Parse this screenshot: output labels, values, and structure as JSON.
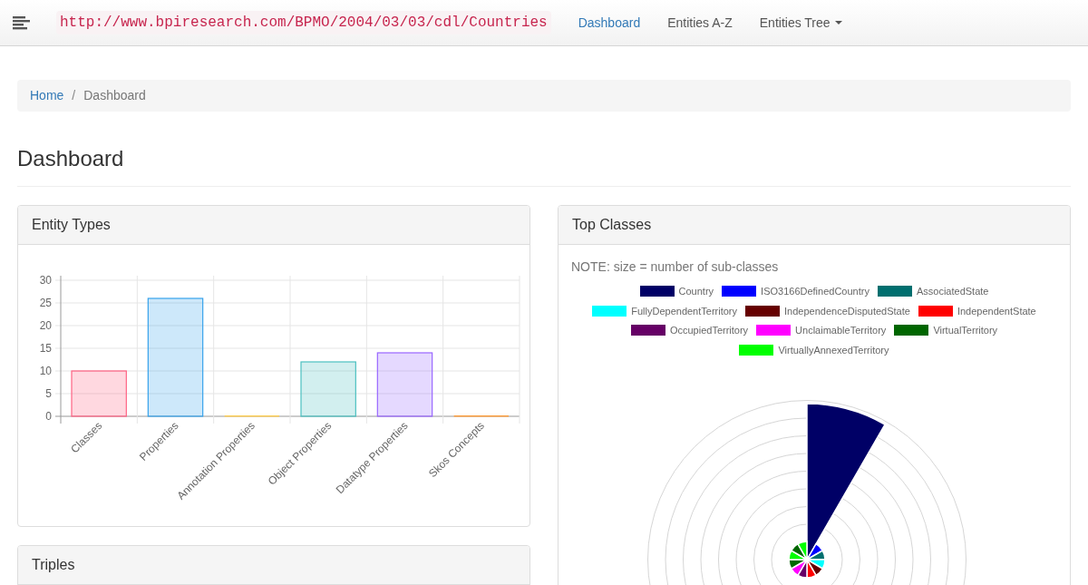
{
  "navbar": {
    "url": "http://www.bpiresearch.com/BPMO/2004/03/03/cdl/Countries",
    "links": [
      {
        "label": "Dashboard",
        "selected": true,
        "dropdown": false
      },
      {
        "label": "Entities A-Z",
        "selected": false,
        "dropdown": false
      },
      {
        "label": "Entities Tree",
        "selected": false,
        "dropdown": true
      }
    ]
  },
  "breadcrumb": {
    "separator": "/",
    "items": [
      {
        "label": "Home",
        "kind": "link"
      },
      {
        "label": "Dashboard",
        "kind": "current"
      }
    ]
  },
  "page_title": "Dashboard",
  "entity_types": {
    "title": "Entity Types",
    "chart_data": {
      "type": "bar",
      "categories": [
        "Classes",
        "Properties",
        "Annotation Properties",
        "Object Properties",
        "Datatype Properties",
        "Skos Concepts"
      ],
      "values": [
        10,
        26,
        0,
        12,
        14,
        0
      ],
      "colors": [
        "#ff6384",
        "#36a2eb",
        "#ffce56",
        "#4bc0c0",
        "#9966ff",
        "#ff9f40"
      ],
      "ylim": [
        0,
        30
      ],
      "yticks": [
        0,
        5,
        10,
        15,
        20,
        25,
        30
      ],
      "grid": true
    }
  },
  "top_classes": {
    "title": "Top Classes",
    "note": "NOTE: size = number of sub-classes",
    "legend": [
      {
        "label": "Country",
        "color": "#000066"
      },
      {
        "label": "ISO3166DefinedCountry",
        "color": "#0000ff"
      },
      {
        "label": "AssociatedState",
        "color": "#006f6f"
      },
      {
        "label": "FullyDependentTerritory",
        "color": "#00ffff"
      },
      {
        "label": "IndependenceDisputedState",
        "color": "#660000"
      },
      {
        "label": "IndependentState",
        "color": "#ff0000"
      },
      {
        "label": "OccupiedTerritory",
        "color": "#660066"
      },
      {
        "label": "UnclaimableTerritory",
        "color": "#ff00ff"
      },
      {
        "label": "VirtualTerritory",
        "color": "#006600"
      },
      {
        "label": "VirtuallyAnnexedTerritory",
        "color": "#00ff00"
      }
    ]
  },
  "triples": {
    "title": "Triples"
  }
}
